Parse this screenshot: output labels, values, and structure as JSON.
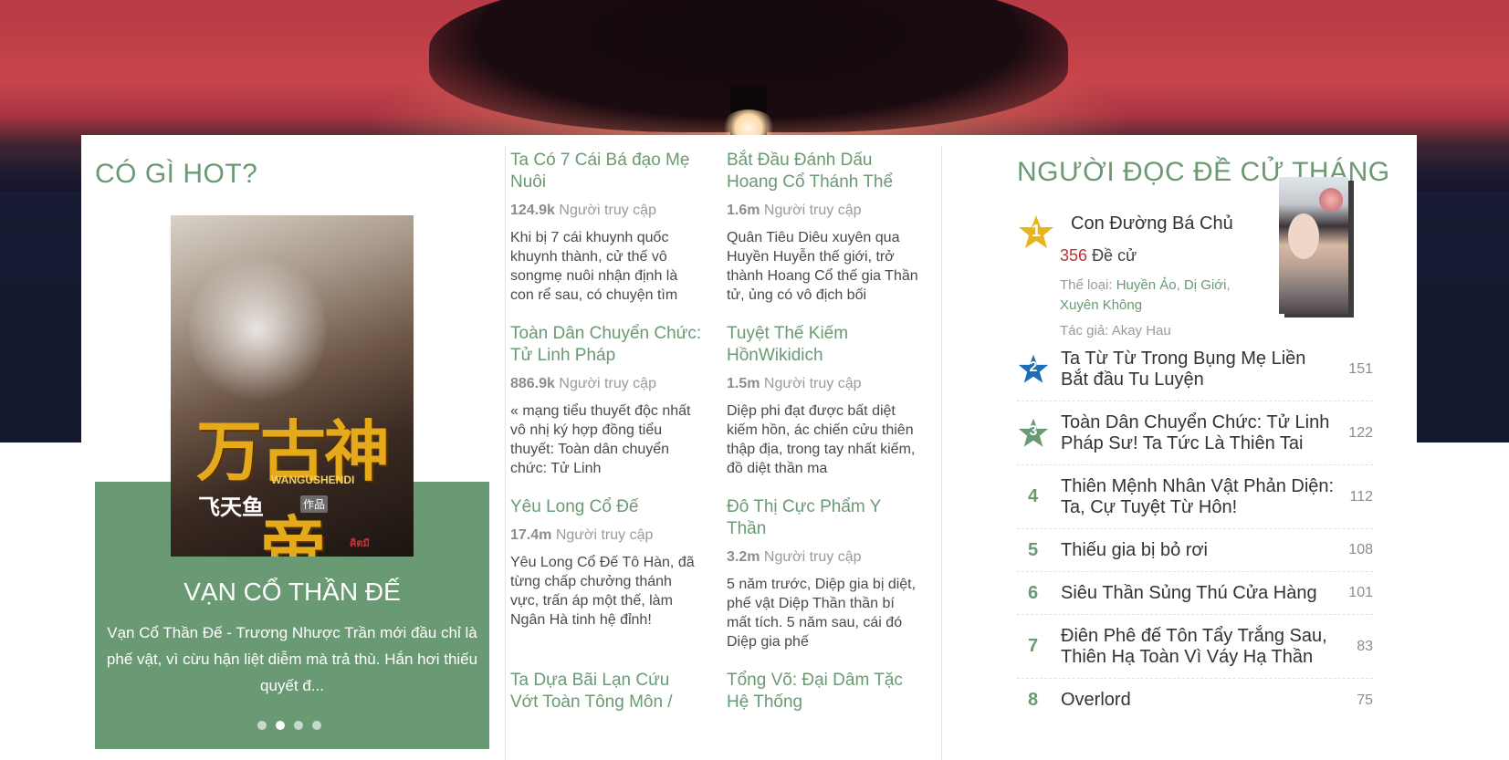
{
  "hot": {
    "title": "CÓ GÌ HOT?",
    "book_name": "VẠN CỔ THẦN ĐẾ",
    "book_desc": "Vạn Cổ Thần Đế - Trương Nhược Trần mới đầu chỉ là phế vật, vì cừu hận liệt diễm mà trả thù. Hắn hơi thiếu quyết đ...",
    "cover_text": {
      "main": "万古神帝",
      "sub": "WANGUSHENDI",
      "author": "飞天鱼",
      "badge": "作品",
      "logo": "คิตมี"
    },
    "dots": 4,
    "active_dot": 1
  },
  "middle": {
    "items": [
      {
        "title": "Ta Có 7 Cái Bá đạo Mẹ Nuôi",
        "views": "124.9k",
        "views_label": "Người truy cập",
        "desc": "Khi bị 7 cái khuynh quốc khuynh thành, cử thế vô songmẹ nuôi nhận định là con rể sau, có chuyện tìm"
      },
      {
        "title": "Bắt Đầu Đánh Dấu Hoang Cổ Thánh Thể",
        "views": "1.6m",
        "views_label": "Người truy cập",
        "desc": "Quân Tiêu Diêu xuyên qua Huyền Huyễn thế giới, trở thành Hoang Cổ thế gia Thần tử, ủng có vô địch bối"
      },
      {
        "title": "Toàn Dân Chuyển Chức: Tử Linh Pháp",
        "views": "886.9k",
        "views_label": "Người truy cập",
        "desc": "« mạng tiểu thuyết độc nhất vô nhị ký hợp đồng tiểu thuyết: Toàn dân chuyển chức: Tử Linh"
      },
      {
        "title": "Tuyệt Thế Kiếm HồnWikidich",
        "views": "1.5m",
        "views_label": "Người truy cập",
        "desc": "Diệp phi đạt được bất diệt kiếm hồn, ác chiến cửu thiên thập địa, trong tay nhất kiếm, đồ diệt thần ma"
      },
      {
        "title": "Yêu Long Cổ Đế",
        "views": "17.4m",
        "views_label": "Người truy cập",
        "desc": "Yêu Long Cổ Đế Tô Hàn, đã từng chấp chưởng thánh vực, trấn áp một thế, làm Ngân Hà tinh hệ đỉnh!"
      },
      {
        "title": "Đô Thị Cực Phẩm Y Thần",
        "views": "3.2m",
        "views_label": "Người truy cập",
        "desc": "5 năm trước, Diệp gia bị diệt, phế vật Diệp Thần thần bí mất tích. 5 năm sau, cái đó Diệp gia phế"
      },
      {
        "title": "Ta Dựa Bãi Lạn Cứu Vớt Toàn Tông Môn /",
        "views": "",
        "views_label": "",
        "desc": ""
      },
      {
        "title": "Tổng Võ: Đại Dâm Tặc Hệ Thống",
        "views": "",
        "views_label": "",
        "desc": ""
      }
    ]
  },
  "ranking": {
    "title": "NGƯỜI ĐỌC ĐỀ CỬ THÁNG",
    "top1": {
      "rank": "1",
      "name": "Con Đường Bá Chủ",
      "votes": "356",
      "votes_label": "Đề cử",
      "genre_label": "Thể loại:",
      "genres": [
        "Huyền Ảo",
        "Dị Giới",
        "Xuyên Không"
      ],
      "author_label": "Tác giả:",
      "author": "Akay Hau"
    },
    "rows": [
      {
        "rank": "2",
        "name": "Ta Từ Từ Trong Bụng Mẹ Liền Bắt đầu Tu Luyện",
        "score": "151",
        "star_color": "#1f6fb5"
      },
      {
        "rank": "3",
        "name": "Toàn Dân Chuyển Chức: Tử Linh Pháp Sư! Ta Tức Là Thiên Tai",
        "score": "122",
        "star_color": "#6a9a73"
      },
      {
        "rank": "4",
        "name": "Thiên Mệnh Nhân Vật Phản Diện: Ta, Cự Tuyệt Từ Hôn!",
        "score": "112"
      },
      {
        "rank": "5",
        "name": "Thiếu gia bị bỏ rơi",
        "score": "108"
      },
      {
        "rank": "6",
        "name": "Siêu Thần Sủng Thú Cửa Hàng",
        "score": "101"
      },
      {
        "rank": "7",
        "name": "Điên Phê đế Tôn Tẩy Trắng Sau, Thiên Hạ Toàn Vì Váy Hạ Thần",
        "score": "83"
      },
      {
        "rank": "8",
        "name": "Overlord",
        "score": "75"
      }
    ]
  },
  "colors": {
    "accent": "#6a9a73",
    "votes": "#b83232",
    "star_gold": "#e8b41a"
  }
}
